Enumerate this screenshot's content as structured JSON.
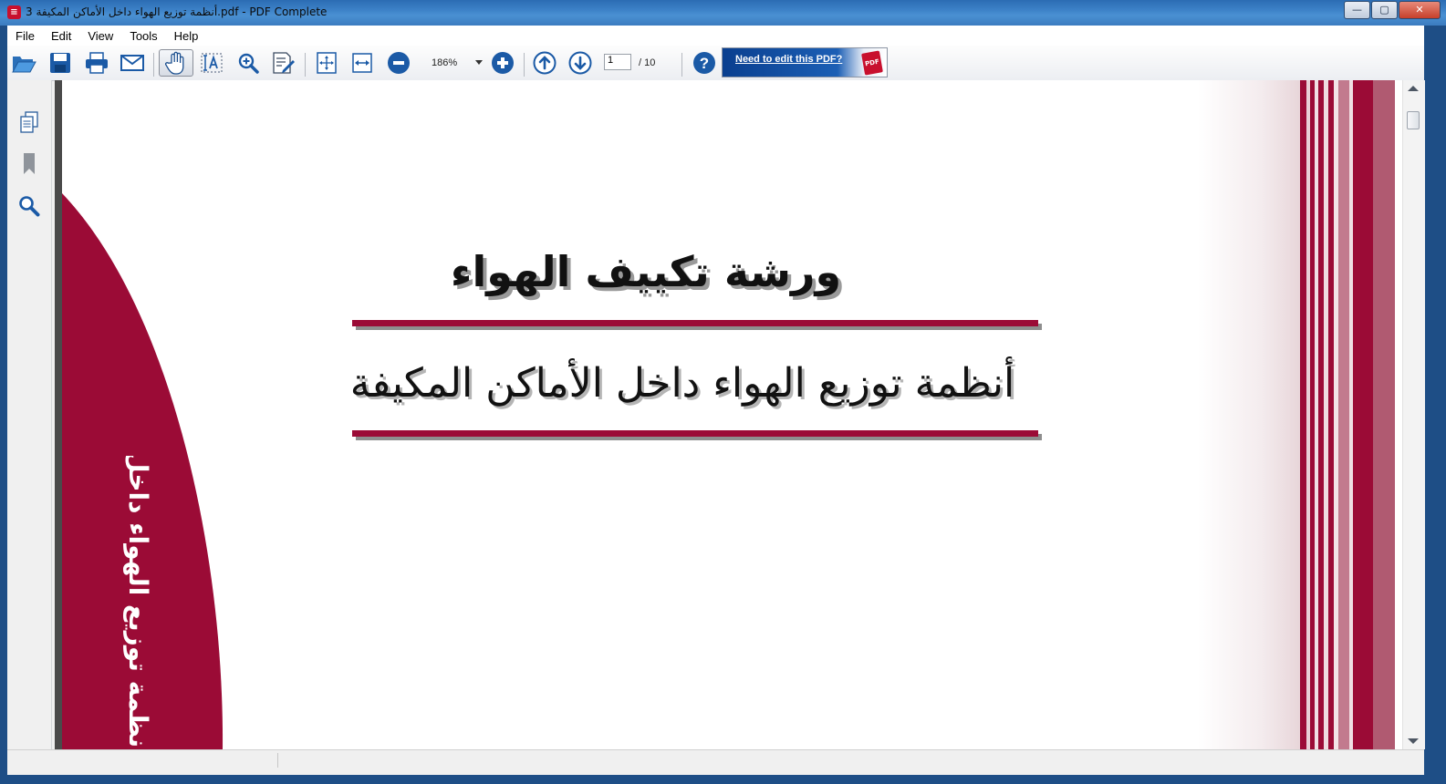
{
  "window": {
    "title": "أنظمة توزيع الهواء داخل الأماكن المكيفة 3.pdf - PDF Complete",
    "minimize": "—",
    "maximize": "▢",
    "close": "✕"
  },
  "menu": [
    "File",
    "Edit",
    "View",
    "Tools",
    "Help"
  ],
  "toolbar": {
    "zoom": "186%",
    "page_current": "1",
    "page_total": "/ 10",
    "promo_link": "Need to edit this PDF?",
    "promo_badge": "PDF"
  },
  "sidebar": {
    "items": [
      "pages-icon",
      "bookmark-icon",
      "search-icon"
    ]
  },
  "document": {
    "title": "ورشة تكييف الهواء",
    "subtitle": "أنظمة توزيع الهواء داخل الأماكن المكيفة",
    "vertical_text": "أنظمة توزيع الهواء داخل ا"
  },
  "colors": {
    "accent": "#9b0b36",
    "chrome": "#1e4e86"
  }
}
